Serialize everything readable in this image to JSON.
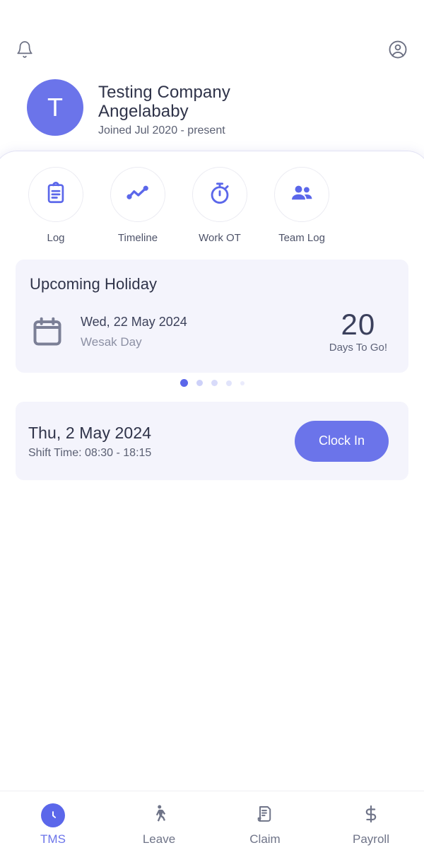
{
  "topbar": {
    "notification_icon": "bell-icon",
    "account_icon": "account-circle-icon"
  },
  "profile": {
    "avatar_initial": "T",
    "company_name": "Testing Company",
    "user_name": "Angelababy",
    "joined": "Joined Jul 2020 - present"
  },
  "quick_actions": [
    {
      "label": "Log",
      "icon": "clipboard-icon"
    },
    {
      "label": "Timeline",
      "icon": "trending-line-icon"
    },
    {
      "label": "Work OT",
      "icon": "stopwatch-icon"
    },
    {
      "label": "Team Log",
      "icon": "people-group-icon"
    }
  ],
  "holiday": {
    "title": "Upcoming Holiday",
    "icon": "calendar-icon",
    "date": "Wed, 22 May 2024",
    "name": "Wesak Day",
    "days_count": "20",
    "days_label": "Days To Go!"
  },
  "carousel": {
    "total_dots": 5,
    "active_index": 0
  },
  "shift": {
    "date": "Thu, 2 May 2024",
    "time": "Shift Time: 08:30 - 18:15",
    "clock_button": "Clock In"
  },
  "bottom_nav": {
    "active_index": 0,
    "items": [
      {
        "label": "TMS",
        "icon": "clock-icon"
      },
      {
        "label": "Leave",
        "icon": "walking-person-icon"
      },
      {
        "label": "Claim",
        "icon": "receipt-icon"
      },
      {
        "label": "Payroll",
        "icon": "dollar-icon"
      }
    ]
  },
  "colors": {
    "accent": "#6b74ea",
    "accent_dot": "#5b67ea",
    "card_bg": "#f4f4fc",
    "text_dark": "#2f3349",
    "text_muted": "#8c90a4"
  }
}
